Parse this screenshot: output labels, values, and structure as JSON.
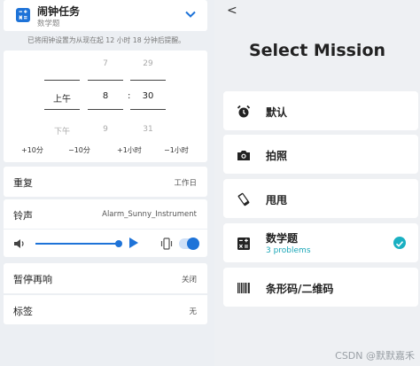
{
  "left": {
    "header": {
      "title": "闹钟任务",
      "subtitle": "数学题"
    },
    "hint": "已将闹钟设置为从现在起 12 小时 18 分钟后提醒。",
    "picker": {
      "ampm": {
        "above": "",
        "current": "上午",
        "below": "下午"
      },
      "hour": {
        "above": "7",
        "current": "8",
        "below": "9"
      },
      "minute": {
        "above": "29",
        "current": "30",
        "below": "31"
      },
      "colon": ":"
    },
    "adjust": [
      "+10分",
      "−10分",
      "+1小时",
      "−1小时"
    ],
    "repeat": {
      "label": "重复",
      "value": "工作日"
    },
    "ringtone": {
      "label": "铃声",
      "value": "Alarm_Sunny_Instrument",
      "volume_fraction": 0.97,
      "vibrate_on": true
    },
    "snooze": {
      "label": "暂停再响",
      "value": "关闭"
    },
    "tag": {
      "label": "标签",
      "value": "无"
    }
  },
  "right": {
    "back": "<",
    "title": "Select Mission",
    "missions": [
      {
        "label": "默认",
        "icon": "alarm-clock-icon"
      },
      {
        "label": "拍照",
        "icon": "camera-icon"
      },
      {
        "label": "甩甩",
        "icon": "phone-shake-icon"
      },
      {
        "label": "数学题",
        "sub": "3 problems",
        "icon": "calculator-icon",
        "selected": true
      },
      {
        "label": "条形码/二维码",
        "icon": "barcode-icon"
      }
    ],
    "watermark": "CSDN @默默嘉禾"
  },
  "colors": {
    "accent": "#1e73d8",
    "check": "#1ab0c2",
    "panel_bg": "#eceff3",
    "right_bg": "#eef0f3"
  }
}
